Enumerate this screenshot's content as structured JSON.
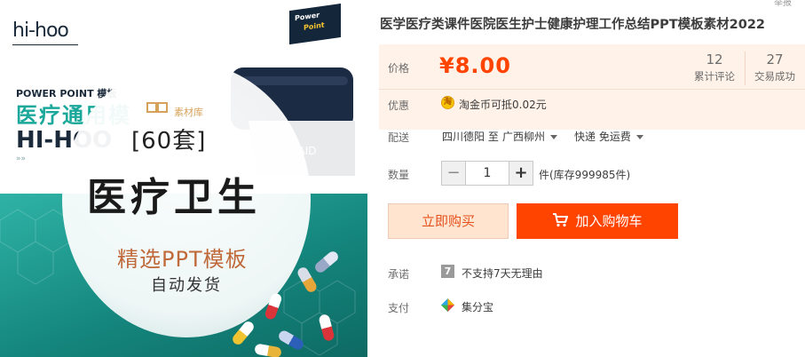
{
  "product_image": {
    "brand": "hi-hoo",
    "badge_line1": "Power",
    "badge_line2": "Point",
    "heading_small": "POWER POINT 模板",
    "heading_big": "医疗通用模",
    "heading_brand": "HI-HOO",
    "arrows": "»»",
    "kit_label": "FIRST AID",
    "store_logo": "素材库",
    "count": "[60套]",
    "main_title": "医疗卫生",
    "tagline": "精选PPT模板",
    "subtagline": "自动发货"
  },
  "title": "医学医疗类课件医院医生护士健康护理工作总结PPT模板素材2022",
  "corner_link": "举报",
  "price": {
    "label": "价格",
    "value": "¥8.00",
    "reviews_count": "12",
    "reviews_label": "累计评论",
    "sold_count": "27",
    "sold_label": "交易成功"
  },
  "promo": {
    "label": "优惠",
    "icon_text": "淘",
    "text": "淘金币可抵0.02元"
  },
  "shipping": {
    "label": "配送",
    "from": "四川德阳 至",
    "to": "广西柳州",
    "method": "快递 免运费"
  },
  "quantity": {
    "label": "数量",
    "value": "1",
    "minus": "−",
    "plus": "+",
    "stock": "件(库存999985件)"
  },
  "actions": {
    "buy_now": "立即购买",
    "add_cart": "加入购物车"
  },
  "promise": {
    "label": "承诺",
    "icon_text": "7",
    "text": "不支持7天无理由"
  },
  "payment": {
    "label": "支付",
    "text": "集分宝"
  },
  "colors": {
    "accent": "#ff4400",
    "price_bg": "#fff2e8",
    "teal": "#1aa89a"
  }
}
